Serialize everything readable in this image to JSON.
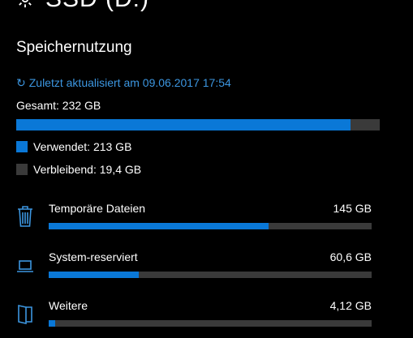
{
  "drive": {
    "title": "SSD (D:)",
    "icon": "gear-icon"
  },
  "storage": {
    "section_title": "Speichernutzung",
    "refresh_label": "Zuletzt aktualisiert am 09.06.2017 17:54",
    "total_label": "Gesamt: 232 GB",
    "used_fraction": 0.92,
    "used_label": "Verwendet: 213 GB",
    "free_label": "Verbleibend: 19,4 GB"
  },
  "categories": [
    {
      "name": "Temporäre Dateien",
      "size": "145 GB",
      "fraction": 0.68,
      "icon": "trash-icon"
    },
    {
      "name": "System-reserviert",
      "size": "60,6 GB",
      "fraction": 0.28,
      "icon": "laptop-icon"
    },
    {
      "name": "Weitere",
      "size": "4,12 GB",
      "fraction": 0.02,
      "icon": "folder-icon"
    }
  ],
  "colors": {
    "accent": "#0a78d7",
    "link": "#3c96e0",
    "track": "#3a3a3a",
    "background": "#000000"
  }
}
